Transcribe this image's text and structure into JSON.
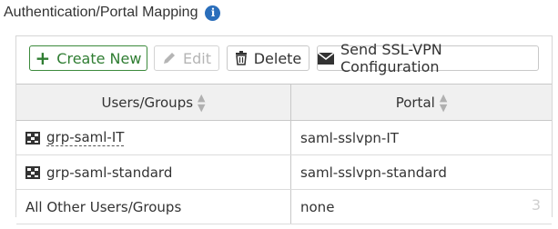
{
  "section": {
    "title": "Authentication/Portal Mapping",
    "info_icon": "info-icon"
  },
  "toolbar": {
    "create_label": "Create New",
    "edit_label": "Edit",
    "delete_label": "Delete",
    "send_label": "Send SSL-VPN Configuration"
  },
  "table": {
    "columns": [
      "Users/Groups",
      "Portal"
    ],
    "rows": [
      {
        "users": "grp-saml-IT",
        "portal": "saml-sslvpn-IT",
        "icon": "group-icon"
      },
      {
        "users": "grp-saml-standard",
        "portal": "saml-sslvpn-standard",
        "icon": "group-icon"
      },
      {
        "users": "All Other Users/Groups",
        "portal": "none",
        "icon": ""
      }
    ],
    "count": "3"
  },
  "colors": {
    "create_green": "#2f7d32",
    "info_blue": "#2a6ebb"
  }
}
